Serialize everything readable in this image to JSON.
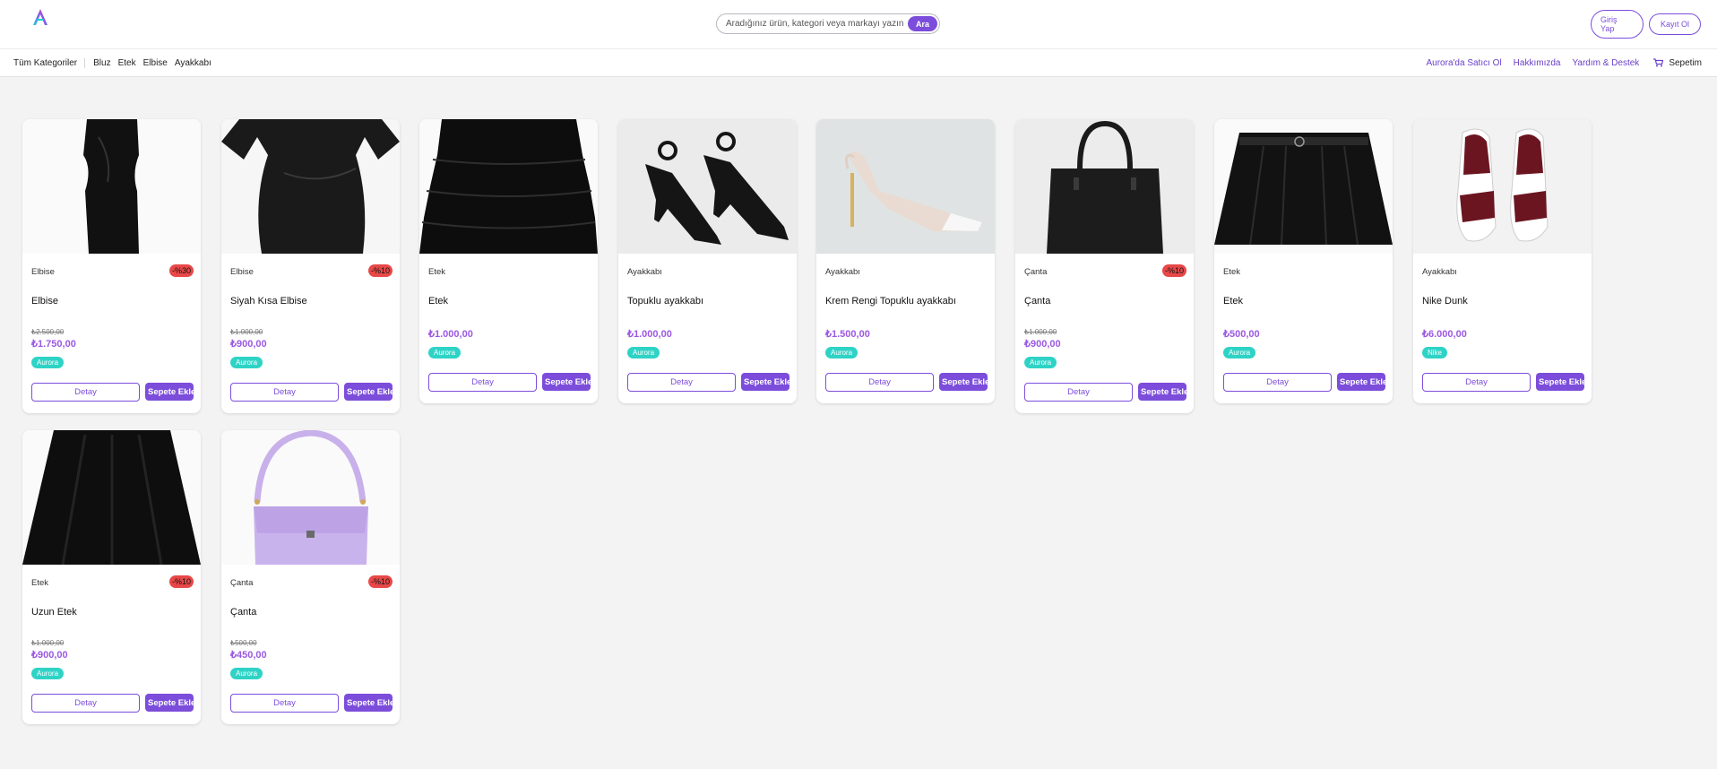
{
  "header": {
    "search_placeholder": "Aradığınız ürün, kategori veya markayı yazın",
    "search_button": "Ara",
    "login": "Giriş Yap",
    "register": "Kayıt Ol"
  },
  "nav": {
    "all_categories": "Tüm Kategoriler",
    "categories": [
      "Bluz",
      "Etek",
      "Elbise",
      "Ayakkabı"
    ],
    "seller": "Aurora'da Satıcı Ol",
    "about": "Hakkımızda",
    "help": "Yardım & Destek",
    "cart": "Sepetim"
  },
  "buttons": {
    "detail": "Detay",
    "add_to_cart": "Sepete Ekle"
  },
  "products": [
    {
      "category": "Elbise",
      "discount": "-%30",
      "name": "Elbise",
      "old_price": "₺2.500,00",
      "price": "₺1.750,00",
      "brand": "Aurora"
    },
    {
      "category": "Elbise",
      "discount": "-%10",
      "name": "Siyah Kısa Elbise",
      "old_price": "₺1.000,00",
      "price": "₺900,00",
      "brand": "Aurora"
    },
    {
      "category": "Etek",
      "discount": "",
      "name": "Etek",
      "old_price": "",
      "price": "₺1.000,00",
      "brand": "Aurora"
    },
    {
      "category": "Ayakkabı",
      "discount": "",
      "name": "Topuklu ayakkabı",
      "old_price": "",
      "price": "₺1.000,00",
      "brand": "Aurora"
    },
    {
      "category": "Ayakkabı",
      "discount": "",
      "name": "Krem Rengi Topuklu ayakkabı",
      "old_price": "",
      "price": "₺1.500,00",
      "brand": "Aurora"
    },
    {
      "category": "Çanta",
      "discount": "-%10",
      "name": "Çanta",
      "old_price": "₺1.000,00",
      "price": "₺900,00",
      "brand": "Aurora"
    },
    {
      "category": "Etek",
      "discount": "",
      "name": "Etek",
      "old_price": "",
      "price": "₺500,00",
      "brand": "Aurora"
    },
    {
      "category": "Ayakkabı",
      "discount": "",
      "name": "Nike Dunk",
      "old_price": "",
      "price": "₺6.000,00",
      "brand": "Nike"
    },
    {
      "category": "Etek",
      "discount": "-%10",
      "name": "Uzun Etek",
      "old_price": "₺1.000,00",
      "price": "₺900,00",
      "brand": "Aurora"
    },
    {
      "category": "Çanta",
      "discount": "-%10",
      "name": "Çanta",
      "old_price": "₺500,00",
      "price": "₺450,00",
      "brand": "Aurora"
    }
  ],
  "colors": {
    "accent": "#7c4ddb",
    "brand_badge": "#2ed3c6",
    "discount_badge": "#e84848",
    "price": "#9b59e3"
  }
}
